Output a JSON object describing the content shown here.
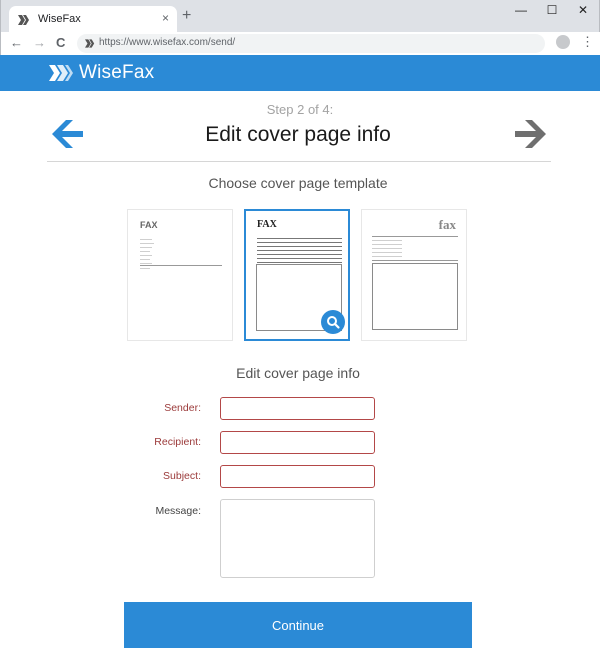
{
  "browser": {
    "tab_title": "WiseFax",
    "tab_close": "×",
    "new_tab": "+",
    "minimize": "—",
    "maximize": "☐",
    "close": "✕",
    "back": "←",
    "forward": "→",
    "reload": "C",
    "url": "https://www.wisefax.com/send/",
    "menu": "⋮"
  },
  "header": {
    "logo_text": "WiseFax",
    "color": "#2b8ad6"
  },
  "wizard": {
    "step_text": "Step 2 of 4:",
    "title": "Edit cover page info",
    "prev_icon": "arrow-left-icon",
    "next_icon": "arrow-right-icon"
  },
  "templates": {
    "heading": "Choose cover page template",
    "items": [
      {
        "id": "template-1",
        "header_text": "FAX",
        "selected": false
      },
      {
        "id": "template-2",
        "header_text": "FAX",
        "selected": true
      },
      {
        "id": "template-3",
        "header_text": "fax",
        "selected": false
      }
    ],
    "preview_icon": "magnifier-icon"
  },
  "form": {
    "heading": "Edit cover page info",
    "sender_label": "Sender:",
    "sender_value": "",
    "recipient_label": "Recipient:",
    "recipient_value": "",
    "subject_label": "Subject:",
    "subject_value": "",
    "message_label": "Message:",
    "message_value": ""
  },
  "actions": {
    "continue_label": "Continue"
  }
}
